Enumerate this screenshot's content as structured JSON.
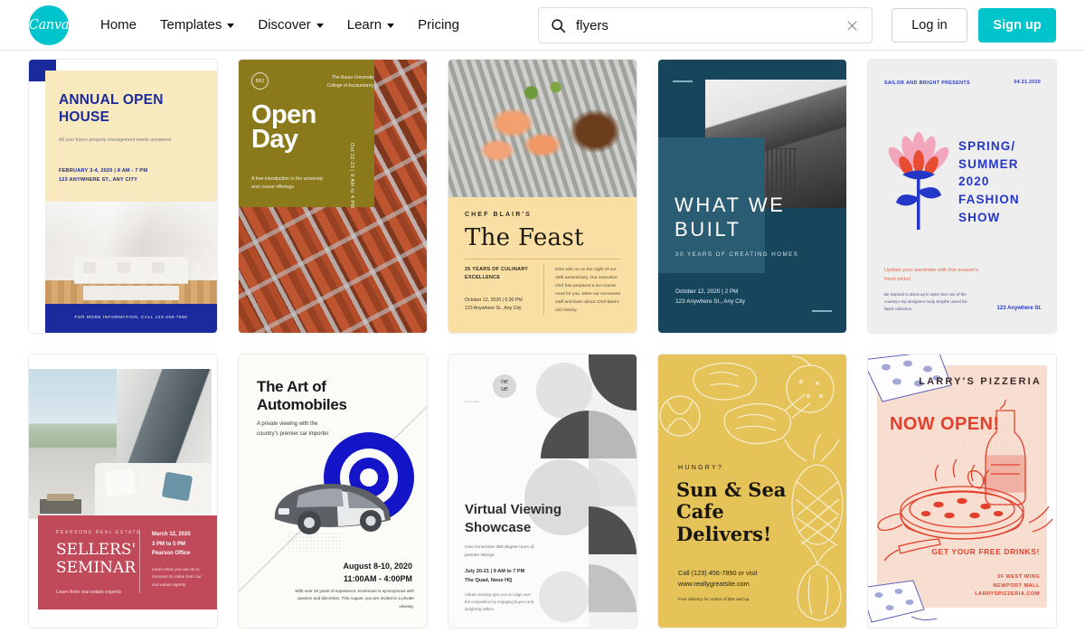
{
  "header": {
    "logo_text": "Canva",
    "nav": [
      {
        "label": "Home",
        "has_caret": false
      },
      {
        "label": "Templates",
        "has_caret": true
      },
      {
        "label": "Discover",
        "has_caret": true
      },
      {
        "label": "Learn",
        "has_caret": true
      },
      {
        "label": "Pricing",
        "has_caret": false
      }
    ],
    "search": {
      "value": "flyers",
      "placeholder": "Search"
    },
    "login_label": "Log in",
    "signup_label": "Sign up",
    "brand_color": "#00C4CC"
  },
  "templates": [
    {
      "name": "annual-open-house",
      "title": "ANNUAL OPEN HOUSE",
      "subtitle": "All your future property management needs answered.",
      "details": "FEBRUARY 3-4, 2020 | 8 AM - 7 PM\n123 ANYWHERE ST., ANY CITY",
      "footer": "FOR MORE INFORMATION, CALL 123-456-7890",
      "accent": "#1B2A9C"
    },
    {
      "name": "open-day",
      "badge": "B/U",
      "org": "The Bauer University\nCollege of Accountancy",
      "title": "Open\nDay",
      "subtitle": "A free introduction to the university and course offerings",
      "vertical_date": "Oct 22-23 | 9 AM to 4 PM",
      "accent": "#8A7A1C"
    },
    {
      "name": "the-feast",
      "eyebrow": "CHEF BLAIR'S",
      "title": "The Feast",
      "left_heading": "25 YEARS OF CULINARY EXCELLENCE",
      "left_details": "October 12, 2020 | 6:30 PM\n123 Anywhere St., Any City",
      "body": "Dine with us on the night of our 25th anniversary. Our executive chef has prepared a six-course meal for you. Meet our renowned staff and learn about Chef Blair's rich history.",
      "accent": "#F9DFA4"
    },
    {
      "name": "what-we-built",
      "title": "WHAT WE BUILT",
      "subtitle": "30 YEARS OF CREATING HOMES",
      "details": "October 12, 2020 | 2 PM\n123 Anywhere St., Any City",
      "accent": "#17465C"
    },
    {
      "name": "spring-summer-fashion-show",
      "presenter": "SAILOR AND BRIGHT PRESENTS",
      "date": "04.21.2020",
      "title": "SPRING/ SUMMER 2020 FASHION SHOW",
      "highlight": "Update your wardrobe with this season's fresh picks!",
      "body": "Be inspired to dress up in style! See one of the country's top designers Andy Smythe unveil his latest collection.",
      "address": "123 Anywhere St.",
      "accent": "#2438C8"
    },
    {
      "name": "sellers-seminar",
      "brand": "PEARSONS REAL ESTATE",
      "title": "SELLERS' SEMINAR",
      "tagline": "Learn from real estate experts",
      "date": "March 12, 2020\n3 PM to 5 PM\nPearson Office",
      "note": "Learn what you can do to increase its value from our real estate agents.",
      "accent": "#C04A5A"
    },
    {
      "name": "art-of-automobiles",
      "title": "The Art of Automobiles",
      "subtitle": "A private viewing with the country's premier car importer",
      "date": "August 8-10, 2020\n11:00AM - 4:00PM",
      "body": "With over 20 years of experience, Kommune is synonymous with passion and discretion. This August, you are invited to a private viewing.",
      "accent": "#1414C8"
    },
    {
      "name": "virtual-viewing-showcase",
      "logo": "ne\nue",
      "logo_sub": "real estate",
      "title": "Virtual Viewing Showcase",
      "subtitle": "Give immersive 360-degree tours of premier listings",
      "details": "July 20-21 | 9 AM to 7 PM\nThe Quad, Neue HQ",
      "body": "Virtual viewings give you an edge over the competition by engaging buyers and delighting sellers.",
      "accent": "#4A4A4A"
    },
    {
      "name": "sun-and-sea-cafe",
      "eyebrow": "HUNGRY?",
      "title": "Sun & Sea Cafe Delivers!",
      "call": "Call (123) 456-7890 or visit www.reallygreatsite.com",
      "note": "Free delivery for orders of $15 and up.",
      "accent": "#E5C358"
    },
    {
      "name": "larrys-pizzeria",
      "title": "LARRY'S PIZZERIA",
      "headline": "NOW OPEN!",
      "offer": "GET YOUR FREE DRINKS!",
      "address": "3F WEST WING\nNEWPORT MALL\nLARRYSPIZZERIA.COM",
      "accent": "#E2402C"
    }
  ]
}
